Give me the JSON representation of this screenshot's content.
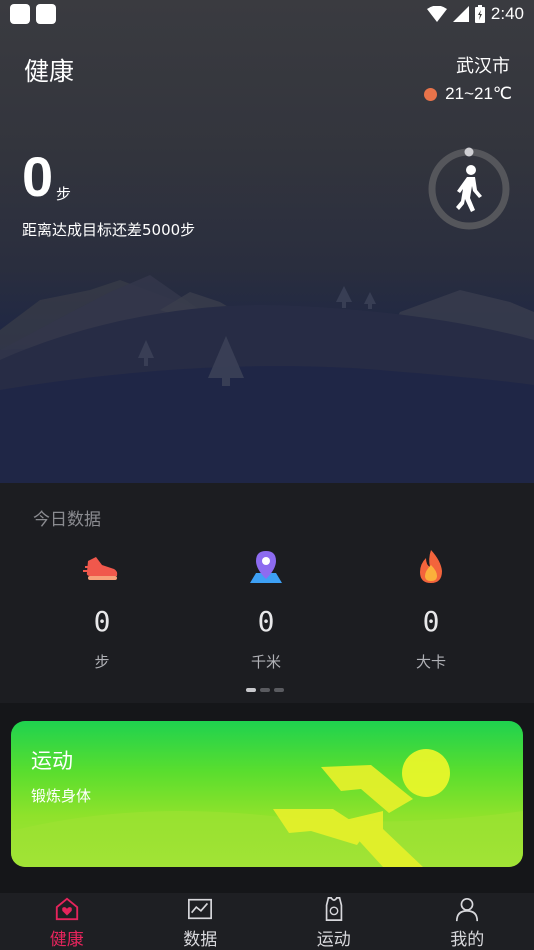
{
  "status_bar": {
    "time": "2:40"
  },
  "header": {
    "title": "健康",
    "city": "武汉市",
    "temperature": "21~21℃"
  },
  "steps": {
    "value": "0",
    "unit": "步",
    "goal_text": "距离达成目标还差5000步"
  },
  "today": {
    "title": "今日数据",
    "stats": [
      {
        "icon": "shoe-icon",
        "value": "0",
        "unit": "步"
      },
      {
        "icon": "location-pin-icon",
        "value": "0",
        "unit": "千米"
      },
      {
        "icon": "flame-icon",
        "value": "0",
        "unit": "大卡"
      }
    ],
    "page_indicator": {
      "count": 3,
      "active": 0
    }
  },
  "sport_card": {
    "title": "运动",
    "subtitle": "锻炼身体"
  },
  "tabs": [
    {
      "label": "健康",
      "icon": "heart-house-icon",
      "active": true
    },
    {
      "label": "数据",
      "icon": "chart-icon",
      "active": false
    },
    {
      "label": "运动",
      "icon": "jersey-icon",
      "active": false
    },
    {
      "label": "我的",
      "icon": "person-icon",
      "active": false
    }
  ],
  "colors": {
    "accent": "#e6245c",
    "weather_dot": "#e8734a",
    "card_green": "#1fd24f",
    "card_lime": "#a6e33a"
  }
}
